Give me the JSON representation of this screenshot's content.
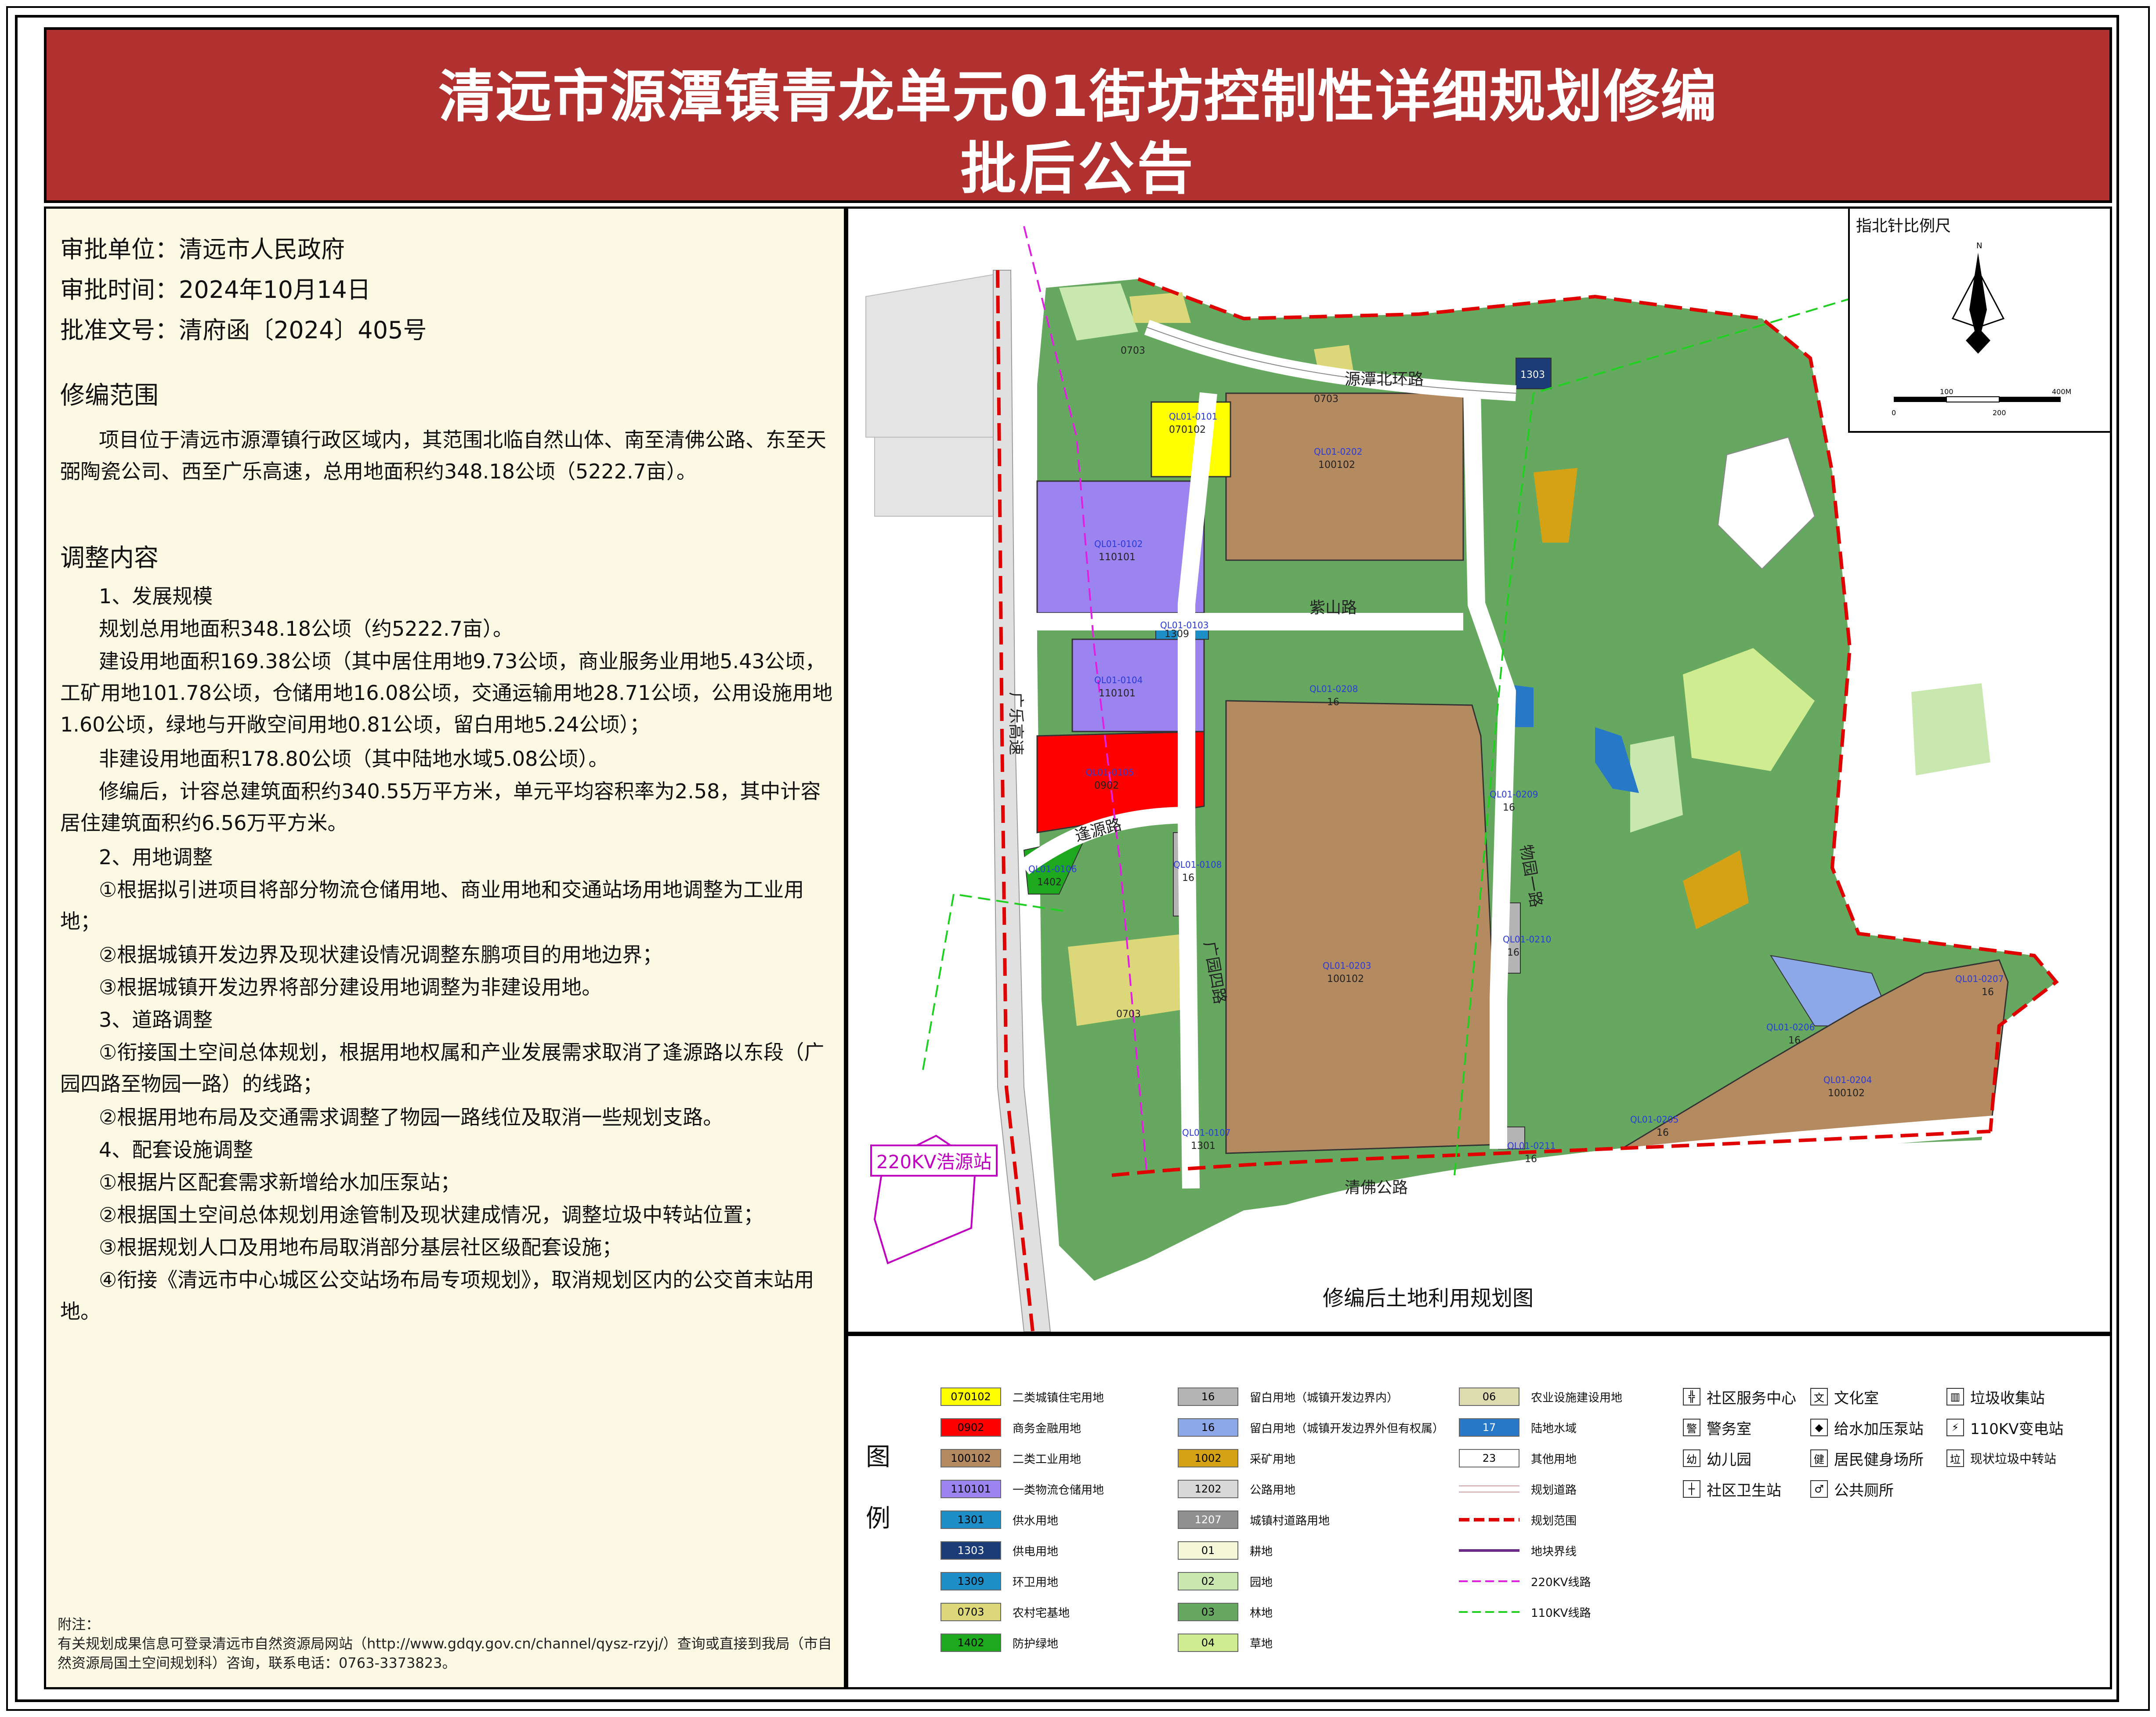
{
  "title": {
    "line1": "清远市源潭镇青龙单元01街坊控制性详细规划修编",
    "line2": "批后公告"
  },
  "approval": {
    "unit": "审批单位：清远市人民政府",
    "time": "审批时间：2024年10月14日",
    "doc": "批准文号：清府函〔2024〕405号"
  },
  "scope": {
    "heading": "修编范围",
    "text": "项目位于清远市源潭镇行政区域内，其范围北临自然山体、南至清佛公路、东至天弼陶瓷公司、西至广乐高速，总用地面积约348.18公顷（5222.7亩）。"
  },
  "adjust": {
    "heading": "调整内容",
    "s1": "1、发展规模",
    "p1": "规划总用地面积348.18公顷（约5222.7亩）。",
    "p2": "建设用地面积169.38公顷（其中居住用地9.73公顷，商业服务业用地5.43公顷，工矿用地101.78公顷，仓储用地16.08公顷，交通运输用地28.71公顷，公用设施用地1.60公顷，绿地与开敞空间用地0.81公顷，留白用地5.24公顷）；",
    "p3": "非建设用地面积178.80公顷（其中陆地水域5.08公顷）。",
    "p4": "修编后，计容总建筑面积约340.55万平方米，单元平均容积率为2.58，其中计容居住建筑面积约6.56万平方米。",
    "s2": "2、用地调整",
    "a1": "①根据拟引进项目将部分物流仓储用地、商业用地和交通站场用地调整为工业用地；",
    "a2": "②根据城镇开发边界及现状建设情况调整东鹏项目的用地边界；",
    "a3": "③根据城镇开发边界将部分建设用地调整为非建设用地。",
    "s3": "3、道路调整",
    "r1": "①衔接国土空间总体规划，根据用地权属和产业发展需求取消了逢源路以东段（广园四路至物园一路）的线路；",
    "r2": "②根据用地布局及交通需求调整了物园一路线位及取消一些规划支路。",
    "s4": "4、配套设施调整",
    "f1": "①根据片区配套需求新增给水加压泵站；",
    "f2": "②根据国土空间总体规划用途管制及现状建成情况，调整垃圾中转站位置；",
    "f3": "③根据规划人口及用地布局取消部分基层社区级配套设施；",
    "f4": "④衔接《清远市中心城区公交站场布局专项规划》，取消规划区内的公交首末站用地。"
  },
  "footnote": {
    "label": "附注：",
    "text": "有关规划成果信息可登录清远市自然资源局网站（http://www.gdqy.gov.cn/channel/qysz-rzyj/）查询或直接到我局（市自然资源局国土空间规划科）咨询，联系电话：0763-3373823。"
  },
  "map": {
    "caption": "修编后土地利用规划图",
    "compass_title": "指北针比例尺",
    "north": "N",
    "scale_labels": [
      "0",
      "100",
      "200",
      "400M"
    ],
    "station": "220KV浩源站",
    "roads": {
      "north_ring": "源潭北环路",
      "zishan": "紫山路",
      "guangle": "广乐高速",
      "fengyuan": "逢源路",
      "guangyuan4": "广园四路",
      "wuyuan1": "物园一路",
      "qingfo": "清佛公路"
    },
    "parcels": [
      {
        "id": "QL01-0101",
        "code": "070102"
      },
      {
        "id": "QL01-0102",
        "code": "110101"
      },
      {
        "id": "QL01-0103",
        "code": "1309"
      },
      {
        "id": "QL01-0104",
        "code": "110101"
      },
      {
        "id": "QL01-0105",
        "code": "0902"
      },
      {
        "id": "QL01-0106",
        "code": "1402"
      },
      {
        "id": "QL01-0107",
        "code": "1301"
      },
      {
        "id": "QL01-0108",
        "code": "16"
      },
      {
        "id": "QL01-0202",
        "code": "100102"
      },
      {
        "id": "QL01-0203",
        "code": "100102"
      },
      {
        "id": "QL01-0204",
        "code": "100102"
      },
      {
        "id": "QL01-0205",
        "code": "16"
      },
      {
        "id": "QL01-0206",
        "code": "16"
      },
      {
        "id": "QL01-0207",
        "code": "16"
      },
      {
        "id": "QL01-0208",
        "code": "16"
      },
      {
        "id": "QL01-0209",
        "code": "16"
      },
      {
        "id": "QL01-0210",
        "code": "16"
      },
      {
        "id": "QL01-0211",
        "code": "16"
      }
    ],
    "misc_labels": {
      "v0703a": "0703",
      "v0703b": "0703",
      "v0703c": "0703",
      "v1303": "1303"
    }
  },
  "legend": {
    "title_a": "图",
    "title_b": "例",
    "swatches": [
      {
        "code": "070102",
        "label": "二类城镇住宅用地",
        "color": "#ffff00",
        "text": "#000"
      },
      {
        "code": "0902",
        "label": "商务金融用地",
        "color": "#ff0000",
        "text": "#000"
      },
      {
        "code": "100102",
        "label": "二类工业用地",
        "color": "#b48a60",
        "text": "#000"
      },
      {
        "code": "110101",
        "label": "一类物流仓储用地",
        "color": "#9c84f0",
        "text": "#000"
      },
      {
        "code": "1301",
        "label": "供水用地",
        "color": "#1e8ec8",
        "text": "#000"
      },
      {
        "code": "1303",
        "label": "供电用地",
        "color": "#1c3c78",
        "text": "#fff"
      },
      {
        "code": "1309",
        "label": "环卫用地",
        "color": "#1e8ec8",
        "text": "#000"
      },
      {
        "code": "0703",
        "label": "农村宅基地",
        "color": "#dcd87a",
        "text": "#000"
      },
      {
        "code": "1402",
        "label": "防护绿地",
        "color": "#1ea81e",
        "text": "#000"
      },
      {
        "code": "16",
        "label": "留白用地（城镇开发边界内）",
        "color": "#b4b4b4",
        "text": "#000"
      },
      {
        "code": "16",
        "label": "留白用地（城镇开发边界外但有权属）",
        "color": "#8ca8e8",
        "text": "#000"
      },
      {
        "code": "1002",
        "label": "采矿用地",
        "color": "#d4a214",
        "text": "#000"
      },
      {
        "code": "1202",
        "label": "公路用地",
        "color": "#d8d8d8",
        "text": "#000"
      },
      {
        "code": "1207",
        "label": "城镇村道路用地",
        "color": "#909090",
        "text": "#fff"
      },
      {
        "code": "01",
        "label": "耕地",
        "color": "#f4f8d8",
        "text": "#000"
      },
      {
        "code": "02",
        "label": "园地",
        "color": "#c8e8b0",
        "text": "#000"
      },
      {
        "code": "03",
        "label": "林地",
        "color": "#66a860",
        "text": "#000"
      },
      {
        "code": "04",
        "label": "草地",
        "color": "#d0ec90",
        "text": "#000"
      },
      {
        "code": "06",
        "label": "农业设施建设用地",
        "color": "#dcdcb0",
        "text": "#000"
      },
      {
        "code": "17",
        "label": "陆地水域",
        "color": "#2878c8",
        "text": "#fff"
      },
      {
        "code": "23",
        "label": "其他用地",
        "color": "#ffffff",
        "text": "#000"
      }
    ],
    "lines": [
      {
        "label": "规划道路"
      },
      {
        "label": "规划范围"
      },
      {
        "label": "地块界线"
      },
      {
        "label": "220KV线路"
      },
      {
        "label": "110KV线路"
      }
    ],
    "icons": [
      {
        "glyph": "╬",
        "label": "社区服务中心"
      },
      {
        "glyph": "警",
        "label": "警务室"
      },
      {
        "glyph": "幼",
        "label": "幼儿园"
      },
      {
        "glyph": "┼",
        "label": "社区卫生站"
      },
      {
        "glyph": "文",
        "label": "文化室"
      },
      {
        "glyph": "◆",
        "label": "给水加压泵站"
      },
      {
        "glyph": "健",
        "label": "居民健身场所"
      },
      {
        "glyph": "♂",
        "label": "公共厕所"
      },
      {
        "glyph": "▥",
        "label": "垃圾收集站"
      },
      {
        "glyph": "⚡",
        "label": "110KV变电站"
      },
      {
        "glyph": "垃",
        "label": "现状垃圾中转站"
      }
    ]
  }
}
